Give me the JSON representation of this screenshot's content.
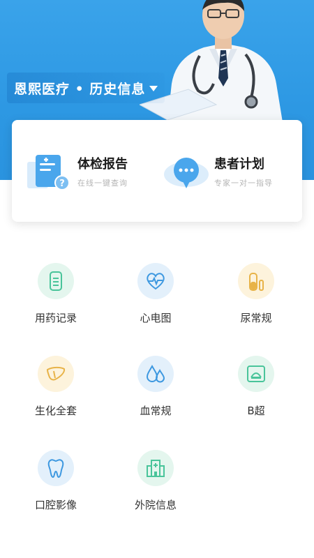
{
  "header": {
    "title": "恩熙医疗 • 历史信息",
    "dropdown_icon": "caret-down-icon",
    "background": "#2f9be6"
  },
  "cards": [
    {
      "title": "体检报告",
      "subtitle": "在线一键查询",
      "icon": "report-icon"
    },
    {
      "title": "患者计划",
      "subtitle": "专家一对一指导",
      "icon": "chat-bubble-icon"
    }
  ],
  "tiles": [
    {
      "label": "用药记录",
      "icon": "medicine-record-icon",
      "bg": "#e4f6ee",
      "color": "#49c49a"
    },
    {
      "label": "心电图",
      "icon": "ecg-icon",
      "bg": "#e3f0fb",
      "color": "#3d98e0"
    },
    {
      "label": "尿常规",
      "icon": "urine-test-icon",
      "bg": "#fdf3dc",
      "color": "#e8b348"
    },
    {
      "label": "生化全套",
      "icon": "liver-icon",
      "bg": "#fdf3dc",
      "color": "#e8b348"
    },
    {
      "label": "血常规",
      "icon": "blood-drop-icon",
      "bg": "#e3f0fb",
      "color": "#3d98e0"
    },
    {
      "label": "B超",
      "icon": "ultrasound-icon",
      "bg": "#e4f6ee",
      "color": "#49c49a"
    },
    {
      "label": "口腔影像",
      "icon": "tooth-icon",
      "bg": "#e3f0fb",
      "color": "#3d98e0"
    },
    {
      "label": "外院信息",
      "icon": "hospital-icon",
      "bg": "#e4f6ee",
      "color": "#49c49a"
    }
  ]
}
